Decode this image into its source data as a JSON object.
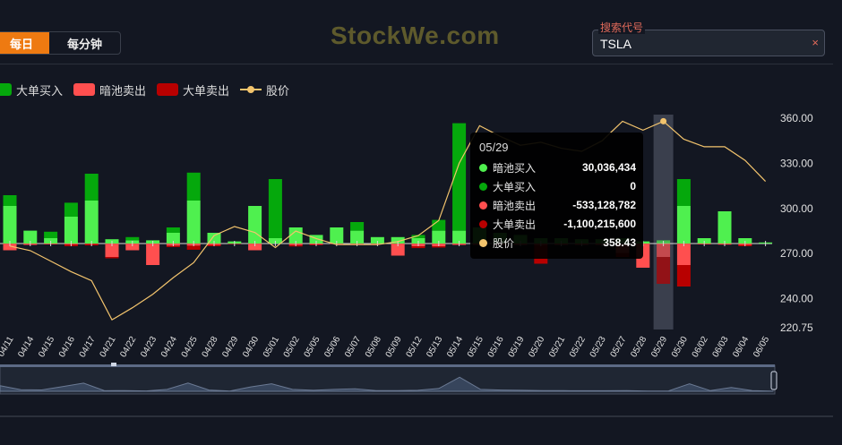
{
  "toolbar": {
    "tab_daily": "每日",
    "tab_minute": "每分钟"
  },
  "brand": "StockWe.com",
  "search": {
    "label": "搜索代号",
    "value": "TSLA",
    "clear": "×"
  },
  "colors": {
    "dark_buy": "#05a80c",
    "dark_sell": "#ff4f4f",
    "block_buy": "#05a80c",
    "block_sell": "#b80000",
    "dark_buy_light": "#4ff04f",
    "price": "#f3c46d",
    "bg": "#131722"
  },
  "legend": [
    {
      "label": "大单买入",
      "color": "#05a80c",
      "kind": "box"
    },
    {
      "label": "暗池卖出",
      "color": "#ff4f4f",
      "kind": "box"
    },
    {
      "label": "大单卖出",
      "color": "#b80000",
      "kind": "box"
    },
    {
      "label": "股价",
      "color": "#f3c46d",
      "kind": "line"
    }
  ],
  "tooltip": {
    "date": "05/29",
    "rows": [
      {
        "label": "暗池买入",
        "value": "30,036,434",
        "color": "#4ff04f"
      },
      {
        "label": "大单买入",
        "value": "0",
        "color": "#05a80c"
      },
      {
        "label": "暗池卖出",
        "value": "-533,128,782",
        "color": "#ff4f4f"
      },
      {
        "label": "大单卖出",
        "value": "-1,100,215,600",
        "color": "#b80000"
      },
      {
        "label": "股价",
        "value": "358.43",
        "color": "#f3c46d"
      }
    ]
  },
  "chart_data": {
    "type": "bar",
    "categories": [
      "04/11",
      "04/14",
      "04/15",
      "04/16",
      "04/17",
      "04/21",
      "04/22",
      "04/23",
      "04/24",
      "04/25",
      "04/28",
      "04/29",
      "04/30",
      "05/01",
      "05/02",
      "05/05",
      "05/06",
      "05/07",
      "05/08",
      "05/09",
      "05/12",
      "05/13",
      "05/14",
      "05/15",
      "05/16",
      "05/19",
      "05/20",
      "05/21",
      "05/22",
      "05/23",
      "05/27",
      "05/28",
      "05/29",
      "05/30",
      "06/02",
      "06/03",
      "06/04",
      "06/05"
    ],
    "series": [
      {
        "name": "暗池买入",
        "values": [
          0.35,
          0.12,
          0.05,
          0.25,
          0.4,
          0.04,
          0.03,
          0.03,
          0.1,
          0.4,
          0.1,
          0.02,
          0.35,
          0.05,
          0.15,
          0.08,
          0.15,
          0.12,
          0.06,
          0.06,
          0.05,
          0.12,
          0.12,
          0.15,
          0.1,
          0.08,
          0.05,
          0.05,
          0.04,
          0.04,
          0.05,
          0.02,
          0.03,
          0.35,
          0.05,
          0.3,
          0.05,
          0.01
        ]
      },
      {
        "name": "大单买入",
        "values": [
          0.1,
          0.0,
          0.06,
          0.13,
          0.25,
          0.0,
          0.03,
          0.0,
          0.05,
          0.26,
          0.0,
          0.0,
          0.0,
          0.55,
          0.0,
          0.0,
          0.0,
          0.08,
          0.0,
          0.0,
          0.03,
          0.1,
          1.0,
          0.0,
          0.0,
          0.0,
          0.0,
          0.0,
          0.0,
          0.0,
          0.0,
          0.0,
          0.0,
          0.25,
          0.0,
          0.0,
          0.0,
          0.0
        ]
      },
      {
        "name": "暗池卖出",
        "values": [
          -0.25,
          -0.05,
          -0.03,
          -0.04,
          -0.02,
          -0.5,
          -0.25,
          -0.8,
          -0.08,
          -0.08,
          -0.05,
          -0.02,
          -0.25,
          -0.0,
          -0.06,
          -0.04,
          -0.02,
          -0.02,
          -0.02,
          -0.45,
          -0.1,
          -0.1,
          -0.05,
          -0.05,
          -0.05,
          -0.05,
          -0.05,
          -0.05,
          -0.05,
          -0.05,
          -0.35,
          -0.9,
          -0.5,
          -0.8,
          -0.03,
          -0.04,
          -0.05,
          -0.0
        ]
      },
      {
        "name": "大单卖出",
        "values": [
          0.0,
          0.0,
          0.0,
          -0.06,
          -0.05,
          -0.05,
          0.0,
          0.0,
          -0.05,
          -0.15,
          -0.05,
          0.0,
          0.0,
          0.0,
          -0.05,
          -0.02,
          0.0,
          0.0,
          0.0,
          0.0,
          -0.07,
          -0.05,
          0.0,
          0.0,
          0.0,
          0.0,
          -0.7,
          0.0,
          0.0,
          0.0,
          -0.15,
          0.0,
          -1.0,
          -0.8,
          0.0,
          0.0,
          -0.05,
          0.0
        ]
      }
    ],
    "price": [
      275,
      272,
      265,
      258,
      252,
      226,
      234,
      243,
      254,
      264,
      282,
      288,
      284,
      274,
      285,
      280,
      276,
      276,
      276,
      278,
      282,
      292,
      330,
      355,
      348,
      342,
      344,
      340,
      338,
      345,
      358,
      352,
      358,
      346,
      341,
      341,
      332,
      318
    ],
    "y_ticks": [
      "360.00",
      "330.00",
      "300.00",
      "270.00",
      "240.00",
      "220.75"
    ],
    "ylim": [
      220.75,
      365
    ],
    "highlight": "05/29",
    "ylabel": "",
    "xlabel": ""
  }
}
